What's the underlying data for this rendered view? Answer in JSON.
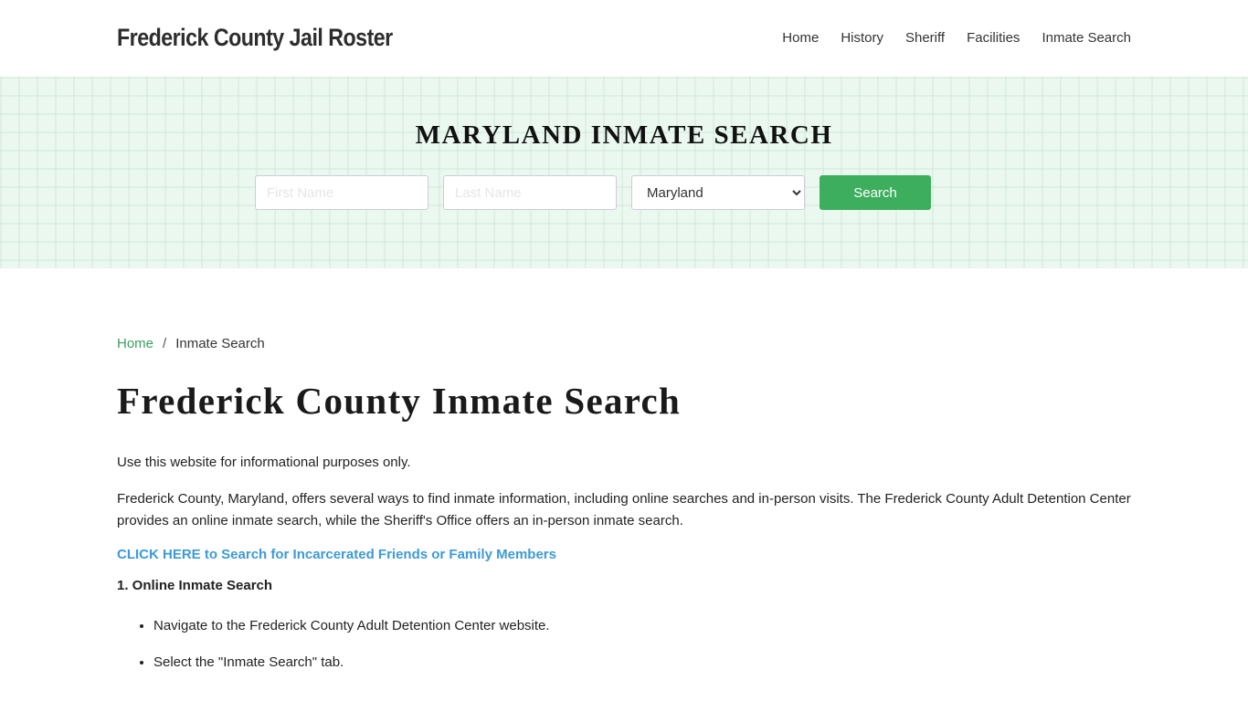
{
  "header": {
    "brand": "Frederick County Jail Roster",
    "nav": [
      "Home",
      "History",
      "Sheriff",
      "Facilities",
      "Inmate Search"
    ]
  },
  "hero": {
    "title": "MARYLAND INMATE SEARCH",
    "first_name_placeholder": "First Name",
    "last_name_placeholder": "Last Name",
    "state_selected": "Maryland",
    "search_label": "Search"
  },
  "breadcrumb": {
    "home": "Home",
    "separator": "/",
    "current": "Inmate Search"
  },
  "main": {
    "title": "Frederick County Inmate Search",
    "p1": "Use this website for informational purposes only.",
    "p2": "Frederick County, Maryland, offers several ways to find inmate information, including online searches and in-person visits. The Frederick County Adult Detention Center provides an online inmate search, while the Sheriff's Office offers an in-person inmate search.",
    "cta": "CLICK HERE to Search for Incarcerated Friends or Family Members",
    "section_heading": "1. Online Inmate Search",
    "steps": [
      "Navigate to the Frederick County Adult Detention Center website.",
      "Select the \"Inmate Search\" tab."
    ]
  },
  "colors": {
    "accent_green": "#3cae5e",
    "link_blue": "#3d9ad6",
    "hero_bg": "#eaf8ef"
  }
}
